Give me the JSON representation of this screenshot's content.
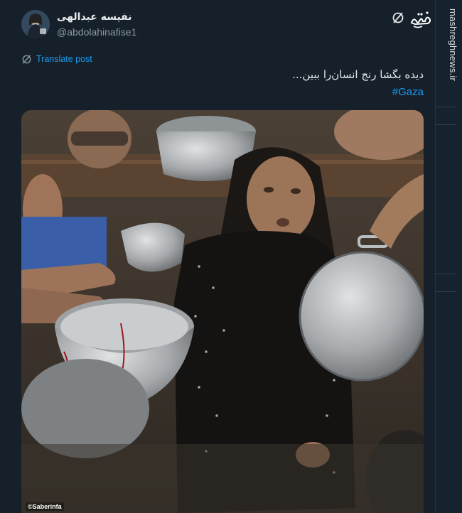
{
  "post": {
    "display_name": "نفیسه عبدالهی",
    "handle": "@abdolahinafise1",
    "translate_label": "Translate post",
    "text": "دیده بگشا رنج انسان‌را ببین...",
    "hashtag": "#Gaza",
    "image_watermark": "©Saberinfa"
  },
  "overlay": {
    "site_url": "mashreghnews.ir",
    "site_logo_text": "مشرق"
  },
  "icons": {
    "grok": "grok-icon",
    "translate": "translate-icon",
    "site_logo": "site-logo-icon"
  },
  "colors": {
    "background": "#15202b",
    "link": "#1d9bf0",
    "secondary_text": "#8b98a5"
  }
}
